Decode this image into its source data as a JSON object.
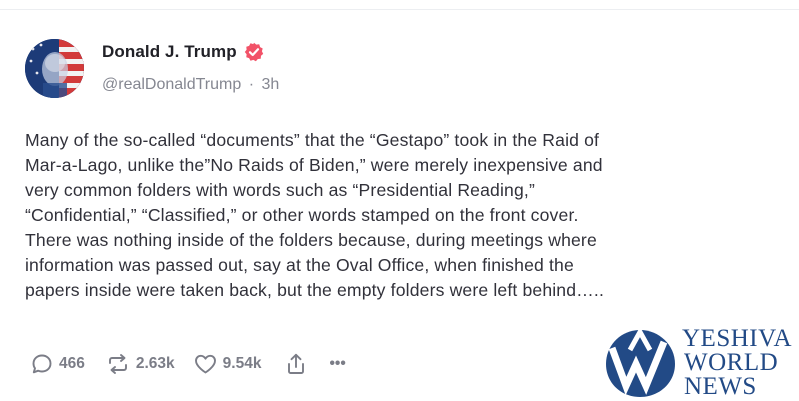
{
  "post": {
    "author_name": "Donald J. Trump",
    "handle": "@realDonaldTrump",
    "separator": "·",
    "time_ago": "3h",
    "text_lines": [
      "Many of the so-called “documents” that the “Gestapo” took in the Raid of",
      "Mar-a-Lago, unlike the”No Raids of Biden,” were merely inexpensive and",
      "very common folders with words such as “Presidential Reading,”",
      "“Confidential,” “Classified,” or other words stamped on the front cover.",
      "There was nothing inside of the folders because, during meetings where",
      "information was passed out, say at the Oval Office, when finished the",
      "papers inside were taken back, but the empty folders were left behind….."
    ]
  },
  "actions": {
    "replies": "466",
    "reposts": "2.63k",
    "likes": "9.54k",
    "more": "•••"
  },
  "watermark": {
    "line1": "YESHIVA",
    "line2": "WORLD",
    "line3": "NEWS"
  },
  "icons": {
    "reply": "reply-bubble-icon",
    "repost": "repost-arrows-icon",
    "like": "heart-icon",
    "share": "share-upload-icon",
    "more": "more-dots-icon",
    "verified": "verified-badge-icon"
  },
  "colors": {
    "verified_badge": "#f25268",
    "watermark": "#224a86",
    "muted_text": "#858791"
  }
}
